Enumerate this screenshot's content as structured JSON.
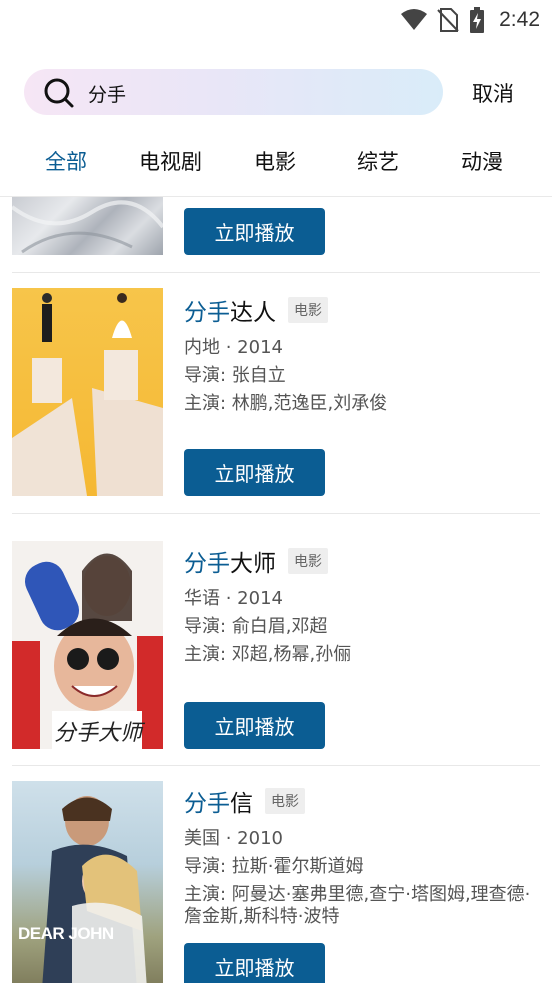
{
  "status_bar": {
    "time": "2:42",
    "icons": [
      "wifi-icon",
      "no-sim-icon",
      "battery-charging-icon"
    ]
  },
  "search": {
    "query": "分手",
    "cancel_label": "取消",
    "icon": "search-icon"
  },
  "tabs": [
    {
      "label": "全部",
      "active": true
    },
    {
      "label": "电视剧",
      "active": false
    },
    {
      "label": "电影",
      "active": false
    },
    {
      "label": "综艺",
      "active": false
    },
    {
      "label": "动漫",
      "active": false
    }
  ],
  "results": [
    {
      "play_label": "立即播放"
    },
    {
      "title_highlight": "分手",
      "title_rest": "达人",
      "type_badge": "电影",
      "region_year": "内地 · 2014",
      "director": "导演:  张自立",
      "cast": "主演:  林鹏,范逸臣,刘承俊",
      "play_label": "立即播放"
    },
    {
      "title_highlight": "分手",
      "title_rest": "大师",
      "type_badge": "电影",
      "region_year": "华语 · 2014",
      "director": "导演:  俞白眉,邓超",
      "cast": "主演:  邓超,杨幂,孙俪",
      "play_label": "立即播放",
      "poster_text": "分手大师"
    },
    {
      "title_highlight": "分手",
      "title_rest": "信",
      "type_badge": "电影",
      "region_year": "美国 · 2010",
      "director": "导演:  拉斯·霍尔斯道姆",
      "cast": "主演:  阿曼达·塞弗里德,查宁·塔图姆,理查德·詹金斯,斯科特·波特",
      "play_label": "立即播放",
      "poster_text": "DEAR JOHN"
    }
  ],
  "colors": {
    "accent": "#0b5d93",
    "divider": "#e8e8e8"
  }
}
